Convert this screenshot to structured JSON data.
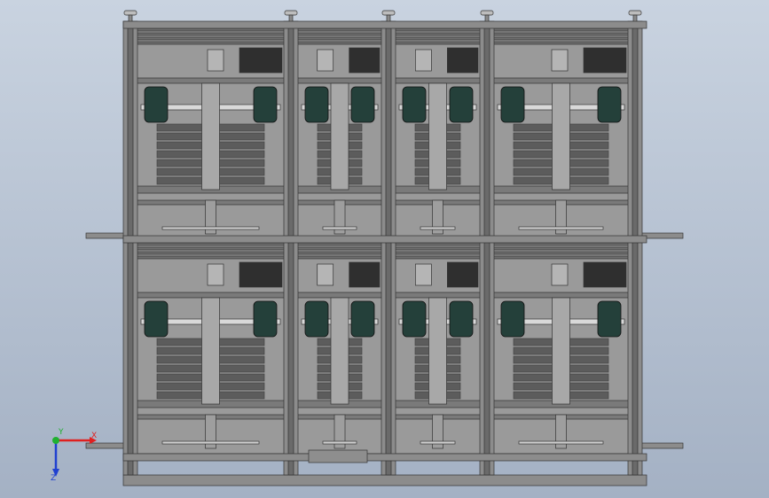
{
  "viewport": {
    "background_top": "#c9d3e0",
    "background_bottom": "#a4b1c4"
  },
  "model": {
    "frame_color": "#8c8c8c",
    "panel_color": "#9a9a9a",
    "dark_color": "#3a3a3a",
    "wheel_color": "#24403a",
    "motor_color": "#2f2f2f",
    "columns": 4,
    "rows": 2
  },
  "triad": {
    "x_label": "X",
    "y_label": "Y",
    "z_label": "Z",
    "x_color": "#e02020",
    "y_color": "#20b030",
    "z_color": "#2040d0"
  }
}
